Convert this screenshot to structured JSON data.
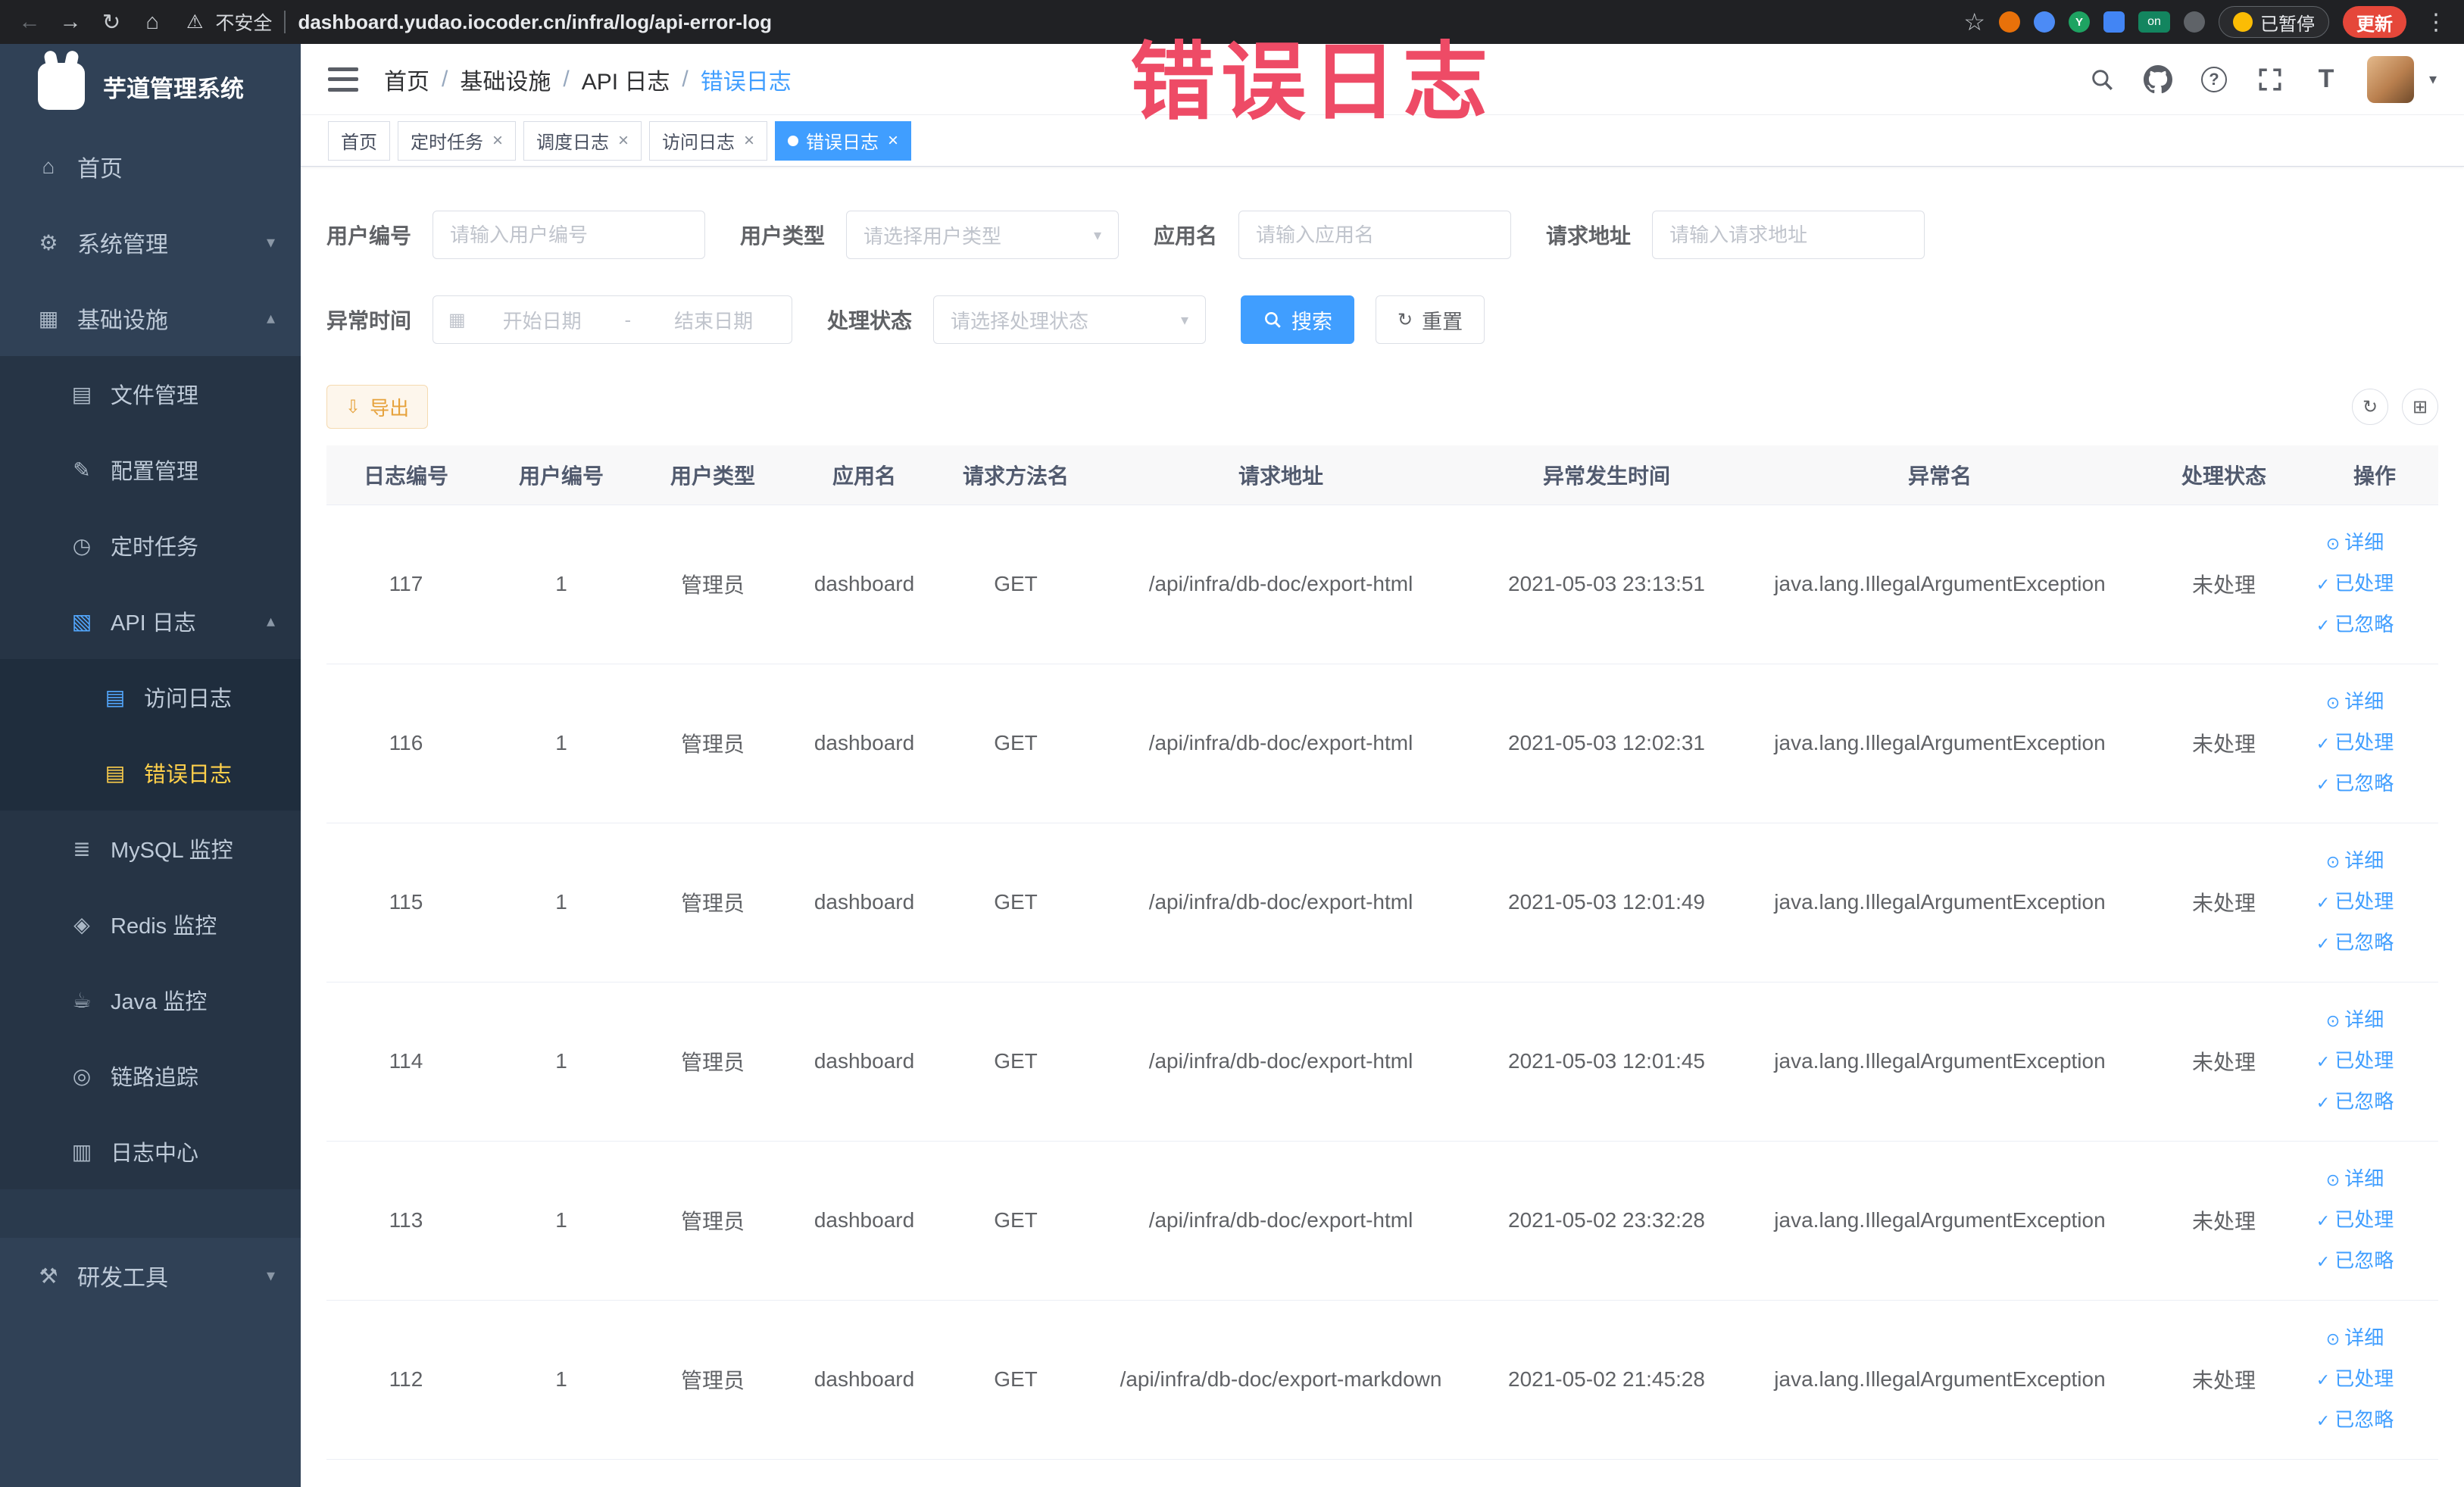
{
  "colors": {
    "primary": "#409eff",
    "menu_active_text": "#ffd04b",
    "sidebar_bg": "#304156",
    "warning": "#e6a23c",
    "annotation": "#ee4b66",
    "chrome_bg": "#202124"
  },
  "browser": {
    "security_label": "不安全",
    "url": "dashboard.yudao.iocoder.cn/infra/log/api-error-log",
    "paused_badge": "已暂停",
    "update_button": "更新",
    "extension_on_badge": "on",
    "extension_letter": "Y"
  },
  "icons": {
    "back": "←",
    "forward": "→",
    "reload": "↻",
    "home": "⌂",
    "warning": "⚠",
    "star": "☆",
    "kebab": "⋮",
    "menu_home": "⌂",
    "menu_gear": "⚙",
    "menu_infra": "▦",
    "menu_file": "▤",
    "menu_config": "✎",
    "menu_timer": "◷",
    "menu_api": "▧",
    "menu_doc": "▤",
    "menu_mysql": "≣",
    "menu_redis": "◈",
    "menu_java": "☕",
    "menu_trace": "◎",
    "menu_logcenter": "▥",
    "menu_tools": "⚒",
    "chevron_down": "▾",
    "chevron_up": "▴",
    "caret_down": "▾",
    "question": "?",
    "font_size": "T",
    "calendar": "▦",
    "refresh": "↻",
    "download": "⇩",
    "columns": "⊞",
    "close": "×",
    "eye": "⊙",
    "check": "✓"
  },
  "sidebar": {
    "logo_title": "芋道管理系统",
    "menu": [
      {
        "label": "首页"
      },
      {
        "label": "系统管理"
      },
      {
        "label": "基础设施",
        "children": [
          {
            "label": "文件管理"
          },
          {
            "label": "配置管理"
          },
          {
            "label": "定时任务"
          },
          {
            "label": "API 日志",
            "children": [
              {
                "label": "访问日志"
              },
              {
                "label": "错误日志",
                "active": true
              }
            ]
          },
          {
            "label": "MySQL 监控"
          },
          {
            "label": "Redis 监控"
          },
          {
            "label": "Java 监控"
          },
          {
            "label": "链路追踪"
          },
          {
            "label": "日志中心"
          }
        ]
      },
      {
        "label": "研发工具"
      }
    ]
  },
  "navbar": {
    "breadcrumb": [
      "首页",
      "基础设施",
      "API 日志",
      "错误日志"
    ],
    "separator": "/"
  },
  "tabs": [
    {
      "label": "首页",
      "closable": false,
      "active": false
    },
    {
      "label": "定时任务",
      "closable": true,
      "active": false
    },
    {
      "label": "调度日志",
      "closable": true,
      "active": false
    },
    {
      "label": "访问日志",
      "closable": true,
      "active": false
    },
    {
      "label": "错误日志",
      "closable": true,
      "active": true
    }
  ],
  "annotation": {
    "text": "错误日志",
    "color": "#ee4b66"
  },
  "filters": {
    "user_id": {
      "label": "用户编号",
      "placeholder": "请输入用户编号"
    },
    "user_type": {
      "label": "用户类型",
      "placeholder": "请选择用户类型"
    },
    "app_name": {
      "label": "应用名",
      "placeholder": "请输入应用名"
    },
    "request_url": {
      "label": "请求地址",
      "placeholder": "请输入请求地址"
    },
    "exception_time": {
      "label": "异常时间",
      "start_placeholder": "开始日期",
      "range_separator": "-",
      "end_placeholder": "结束日期"
    },
    "process_status": {
      "label": "处理状态",
      "placeholder": "请选择处理状态"
    },
    "search_button": "搜索",
    "reset_button": "重置"
  },
  "toolbar": {
    "export_button": "导出"
  },
  "table": {
    "headers": [
      "日志编号",
      "用户编号",
      "用户类型",
      "应用名",
      "请求方法名",
      "请求地址",
      "异常发生时间",
      "异常名",
      "处理状态",
      "操作"
    ],
    "actions": [
      "详细",
      "已处理",
      "已忽略"
    ],
    "rows": [
      {
        "id": "117",
        "user_id": "1",
        "user_type": "管理员",
        "app": "dashboard",
        "method": "GET",
        "url": "/api/infra/db-doc/export-html",
        "time": "2021-05-03 23:13:51",
        "exception": "java.lang.IllegalArgumentException",
        "status": "未处理"
      },
      {
        "id": "116",
        "user_id": "1",
        "user_type": "管理员",
        "app": "dashboard",
        "method": "GET",
        "url": "/api/infra/db-doc/export-html",
        "time": "2021-05-03 12:02:31",
        "exception": "java.lang.IllegalArgumentException",
        "status": "未处理"
      },
      {
        "id": "115",
        "user_id": "1",
        "user_type": "管理员",
        "app": "dashboard",
        "method": "GET",
        "url": "/api/infra/db-doc/export-html",
        "time": "2021-05-03 12:01:49",
        "exception": "java.lang.IllegalArgumentException",
        "status": "未处理"
      },
      {
        "id": "114",
        "user_id": "1",
        "user_type": "管理员",
        "app": "dashboard",
        "method": "GET",
        "url": "/api/infra/db-doc/export-html",
        "time": "2021-05-03 12:01:45",
        "exception": "java.lang.IllegalArgumentException",
        "status": "未处理"
      },
      {
        "id": "113",
        "user_id": "1",
        "user_type": "管理员",
        "app": "dashboard",
        "method": "GET",
        "url": "/api/infra/db-doc/export-html",
        "time": "2021-05-02 23:32:28",
        "exception": "java.lang.IllegalArgumentException",
        "status": "未处理"
      },
      {
        "id": "112",
        "user_id": "1",
        "user_type": "管理员",
        "app": "dashboard",
        "method": "GET",
        "url": "/api/infra/db-doc/export-markdown",
        "time": "2021-05-02 21:45:28",
        "exception": "java.lang.IllegalArgumentException",
        "status": "未处理"
      }
    ]
  }
}
